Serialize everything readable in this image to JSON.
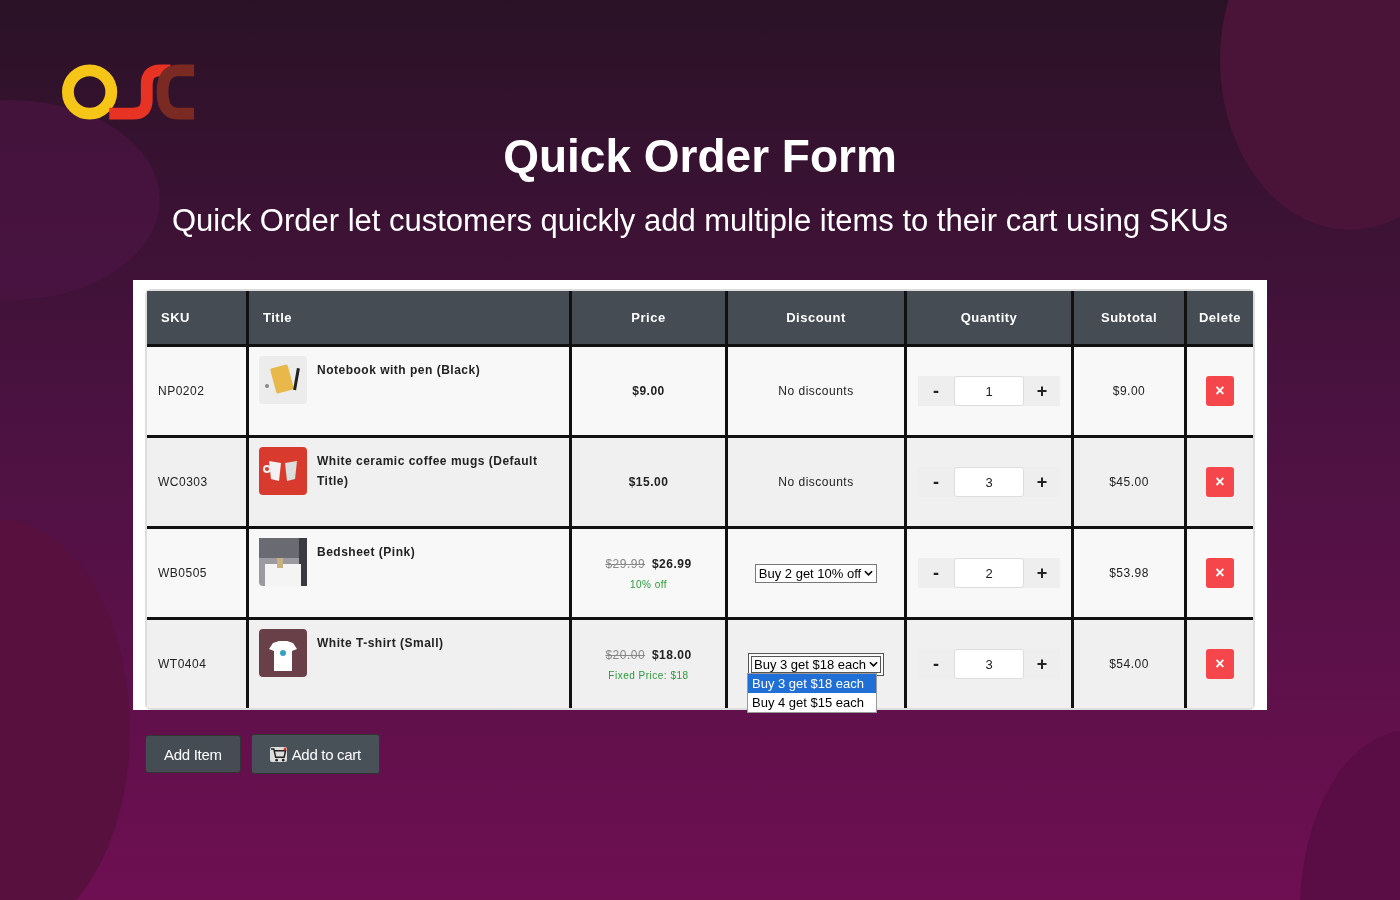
{
  "header": {
    "title": "Quick Order Form",
    "subtitle": "Quick Order let customers quickly add multiple items to their cart using SKUs"
  },
  "table": {
    "columns": [
      "SKU",
      "Title",
      "Price",
      "Discount",
      "Quantity",
      "Subtotal",
      "Delete"
    ],
    "rows": [
      {
        "sku": "NP0202",
        "title": "Notebook with pen (Black)",
        "price": "$9.00",
        "discount": {
          "kind": "text",
          "text": "No discounts"
        },
        "quantity": "1",
        "subtotal": "$9.00"
      },
      {
        "sku": "WC0303",
        "title": "White ceramic coffee mugs (Default Title)",
        "price": "$15.00",
        "discount": {
          "kind": "text",
          "text": "No discounts"
        },
        "quantity": "3",
        "subtotal": "$45.00"
      },
      {
        "sku": "WB0505",
        "title": "Bedsheet (Pink)",
        "old_price": "$29.99",
        "price": "$26.99",
        "price_note": "10% off",
        "discount": {
          "kind": "select",
          "value": "Buy 2 get 10% off",
          "expanded": false
        },
        "quantity": "2",
        "subtotal": "$53.98"
      },
      {
        "sku": "WT0404",
        "title": "White T-shirt (Small)",
        "old_price": "$20.00",
        "price": "$18.00",
        "price_note": "Fixed Price: $18",
        "discount": {
          "kind": "select",
          "value": "Buy 3 get $18 each",
          "expanded": true,
          "options": [
            {
              "label": "Buy 3 get $18 each",
              "selected": true
            },
            {
              "label": "Buy 4 get $15 each",
              "selected": false
            }
          ]
        },
        "quantity": "3",
        "subtotal": "$54.00"
      }
    ]
  },
  "quantity_buttons": {
    "decrease": "-",
    "increase": "+"
  },
  "delete_symbol": "×",
  "buttons": {
    "add_item": "Add Item",
    "add_to_cart": "Add to cart"
  }
}
